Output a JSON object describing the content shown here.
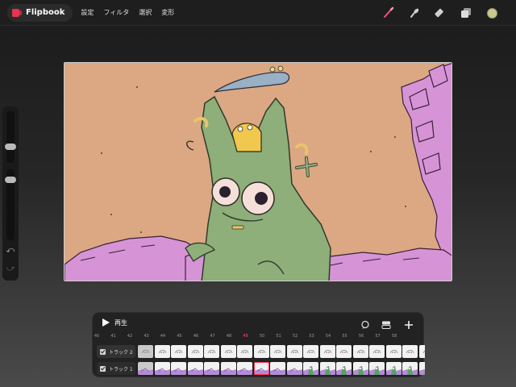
{
  "app": {
    "name": "Flipbook",
    "brand_color": "#e8344e"
  },
  "menu": [
    "設定",
    "フィルタ",
    "選択",
    "変形"
  ],
  "tools": [
    {
      "name": "brush",
      "icon": "brush-icon",
      "color": "#ff4f78",
      "active": true
    },
    {
      "name": "smudge",
      "icon": "smudge-icon",
      "color": "#cfcfcf"
    },
    {
      "name": "eraser",
      "icon": "eraser-icon",
      "color": "#cfcfcf"
    },
    {
      "name": "layers",
      "icon": "layers-icon",
      "color": "#cfcfcf"
    },
    {
      "name": "color",
      "icon": "color-swatch-icon",
      "color": "#c9c98f"
    }
  ],
  "sidebar": {
    "size_slider_value": 0.25,
    "opacity_slider_value": 0.8,
    "undo_icon": "undo-icon",
    "redo_icon": "redo-icon"
  },
  "canvas": {
    "background": "#dba883"
  },
  "timeline": {
    "play_label": "再生",
    "icons": [
      "onion-skin-icon",
      "track-settings-icon",
      "add-icon"
    ],
    "frame_numbers": [
      "40",
      "41",
      "42",
      "43",
      "44",
      "45",
      "46",
      "47",
      "48",
      "49",
      "50",
      "51",
      "52",
      "53",
      "54",
      "55",
      "56",
      "57",
      "58"
    ],
    "current_frame": "49",
    "tracks": [
      {
        "name": "トラック 2",
        "checked": true
      },
      {
        "name": "トラック 1",
        "checked": true
      }
    ]
  }
}
